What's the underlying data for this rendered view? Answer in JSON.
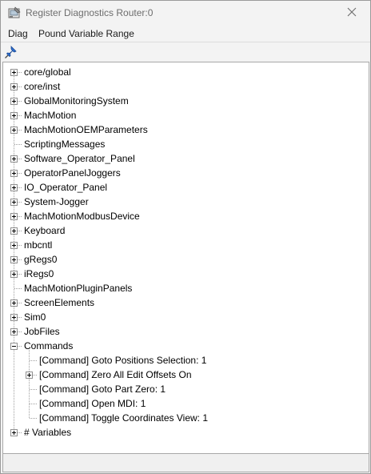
{
  "window": {
    "title": "Register Diagnostics Router:0",
    "app_icon": "router-diagnostics-icon",
    "close_icon": "close-icon"
  },
  "menu": {
    "items": [
      "Diag",
      "Pound Variable Range"
    ]
  },
  "toolbar": {
    "pin_icon": "pushpin-icon"
  },
  "tree": {
    "nodes": [
      {
        "label": "core/global",
        "level": 0,
        "expander": "plus"
      },
      {
        "label": "core/inst",
        "level": 0,
        "expander": "plus"
      },
      {
        "label": "GlobalMonitoringSystem",
        "level": 0,
        "expander": "plus"
      },
      {
        "label": "MachMotion",
        "level": 0,
        "expander": "plus"
      },
      {
        "label": "MachMotionOEMParameters",
        "level": 0,
        "expander": "plus"
      },
      {
        "label": "ScriptingMessages",
        "level": 0,
        "expander": "none"
      },
      {
        "label": "Software_Operator_Panel",
        "level": 0,
        "expander": "plus"
      },
      {
        "label": "OperatorPanelJoggers",
        "level": 0,
        "expander": "plus"
      },
      {
        "label": "IO_Operator_Panel",
        "level": 0,
        "expander": "plus"
      },
      {
        "label": "System-Jogger",
        "level": 0,
        "expander": "plus"
      },
      {
        "label": "MachMotionModbusDevice",
        "level": 0,
        "expander": "plus"
      },
      {
        "label": "Keyboard",
        "level": 0,
        "expander": "plus"
      },
      {
        "label": "mbcntl",
        "level": 0,
        "expander": "plus"
      },
      {
        "label": "gRegs0",
        "level": 0,
        "expander": "plus"
      },
      {
        "label": "iRegs0",
        "level": 0,
        "expander": "plus"
      },
      {
        "label": "MachMotionPluginPanels",
        "level": 0,
        "expander": "none"
      },
      {
        "label": "ScreenElements",
        "level": 0,
        "expander": "plus"
      },
      {
        "label": "Sim0",
        "level": 0,
        "expander": "plus"
      },
      {
        "label": "JobFiles",
        "level": 0,
        "expander": "plus"
      },
      {
        "label": "Commands",
        "level": 0,
        "expander": "minus"
      },
      {
        "label": "[Command] Goto Positions Selection: 1",
        "level": 1,
        "expander": "none"
      },
      {
        "label": "[Command] Zero All Edit Offsets On",
        "level": 1,
        "expander": "plus"
      },
      {
        "label": "[Command] Goto Part Zero: 1",
        "level": 1,
        "expander": "none"
      },
      {
        "label": "[Command] Open MDI: 1",
        "level": 1,
        "expander": "none"
      },
      {
        "label": "[Command] Toggle Coordinates View: 1",
        "level": 1,
        "expander": "none"
      },
      {
        "label": "# Variables",
        "level": 0,
        "expander": "plus"
      }
    ]
  }
}
